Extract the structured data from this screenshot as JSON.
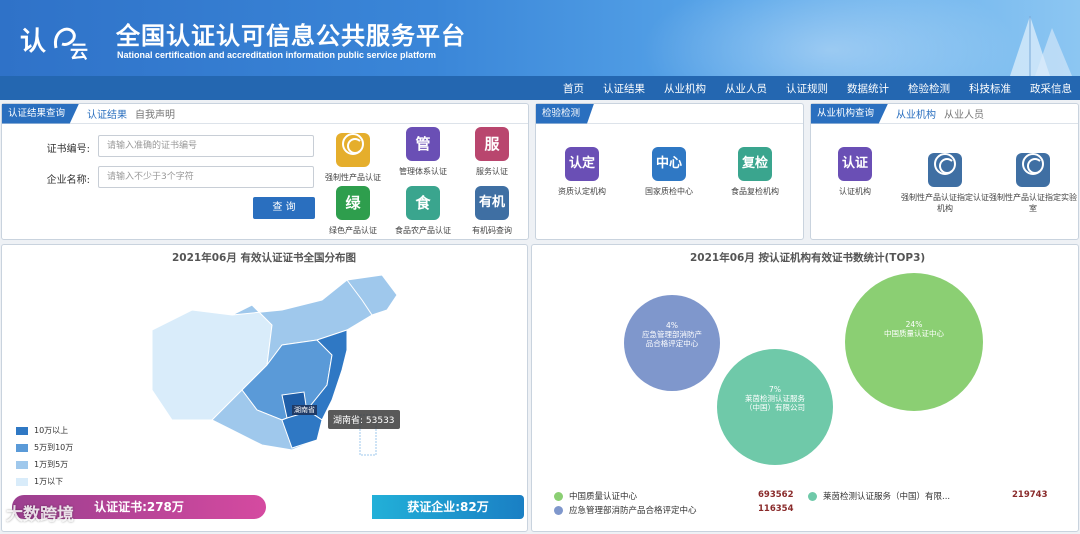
{
  "header": {
    "title": "全国认证认可信息公共服务平台",
    "subtitle": "National certification and accreditation information public service platform"
  },
  "nav": [
    "首页",
    "认证结果",
    "从业机构",
    "从业人员",
    "认证规则",
    "数据统计",
    "检验检测",
    "科技标准",
    "政采信息"
  ],
  "cert_query": {
    "tab_main": "认证结果查询",
    "tabs": [
      "认证结果",
      "自我声明"
    ],
    "cert_no_label": "证书编号:",
    "cert_no_placeholder": "请输入准确的证书编号",
    "company_label": "企业名称:",
    "company_placeholder": "请输入不少于3个字符",
    "query_button": "查 询",
    "services": [
      {
        "icon": "ccc",
        "label": "强制性产品认证",
        "color": "#e5ae2c"
      },
      {
        "icon": "管",
        "label": "管理体系认证",
        "color": "#6a4fb5"
      },
      {
        "icon": "服",
        "label": "服务认证",
        "color": "#b9466e"
      },
      {
        "icon": "绿",
        "label": "绿色产品认证",
        "color": "#2e9e4d"
      },
      {
        "icon": "食",
        "label": "食品农产品认证",
        "color": "#3aa58e"
      },
      {
        "icon": "有机",
        "label": "有机码查询",
        "color": "#3f6fa3"
      }
    ]
  },
  "inspection": {
    "tab_main": "检验检测",
    "items": [
      {
        "icon": "认定",
        "label": "资质认定机构",
        "color": "#6a4fb5"
      },
      {
        "icon": "中心",
        "label": "国家质检中心",
        "color": "#2f78c4"
      },
      {
        "icon": "复检",
        "label": "食品复检机构",
        "color": "#3aa58e"
      }
    ]
  },
  "agency_query": {
    "tab_main": "从业机构查询",
    "tabs": [
      "从业机构",
      "从业人员"
    ],
    "items": [
      {
        "icon": "认证",
        "label": "认证机构",
        "color": "#6a4fb5"
      },
      {
        "icon": "ccc",
        "label": "强制性产品认证指定认证机构",
        "color": "#3f6fa3"
      },
      {
        "icon": "ccc",
        "label": "强制性产品认证指定实验室",
        "color": "#3f6fa3"
      }
    ]
  },
  "map_panel": {
    "title": "2021年06月  有效认证证书全国分布图",
    "legend": [
      {
        "label": "10万以上",
        "color": "#2f78c4"
      },
      {
        "label": "5万到10万",
        "color": "#5a9ad8"
      },
      {
        "label": "1万到5万",
        "color": "#9fc8ec"
      },
      {
        "label": "1万以下",
        "color": "#d9ecfa"
      }
    ],
    "tooltip": "湖南省: 53533",
    "marker": "湖南省",
    "cert_total": "认证证书:278万",
    "enterprise_total": "获证企业:82万",
    "watermark": "大数跨境"
  },
  "bubble_panel": {
    "title": "2021年06月   按认证机构有效证书数统计(TOP3)",
    "bubbles": [
      {
        "pct": "4%",
        "name": "应急管理部消防产品合格评定中心",
        "color": "#7f97cc"
      },
      {
        "pct": "7%",
        "name": "莱茵检测认证服务（中国）有限公司",
        "color": "#6fc9a9"
      },
      {
        "pct": "24%",
        "name": "中国质量认证中心",
        "color": "#8bcf73"
      }
    ],
    "ranking": [
      {
        "name": "中国质量认证中心",
        "value": "693562",
        "color": "#8bcf73"
      },
      {
        "name": "莱茵检测认证服务（中国）有限...",
        "value": "219743",
        "color": "#6fc9a9"
      },
      {
        "name": "应急管理部消防产品合格评定中心",
        "value": "116354",
        "color": "#7f97cc"
      }
    ]
  }
}
